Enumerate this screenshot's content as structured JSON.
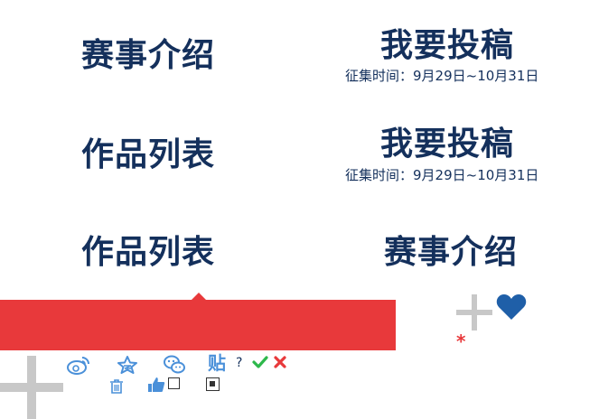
{
  "cards": {
    "intro": "赛事介绍",
    "submit1": "我要投稿",
    "period1": "征集时间：9月29日~10月31日",
    "works1": "作品列表",
    "submit2": "我要投稿",
    "period2": "征集时间：9月29日~10月31日",
    "works2": "作品列表",
    "intro2": "赛事介绍"
  },
  "icons": {
    "question": "?",
    "tieba": "贴",
    "asterisk": "*"
  },
  "colors": {
    "navy": "#14305c",
    "red": "#e8393b",
    "blue": "#4a90d9",
    "heart": "#1f5fa8",
    "green": "#2db84b",
    "gray": "#c8c8c8"
  }
}
